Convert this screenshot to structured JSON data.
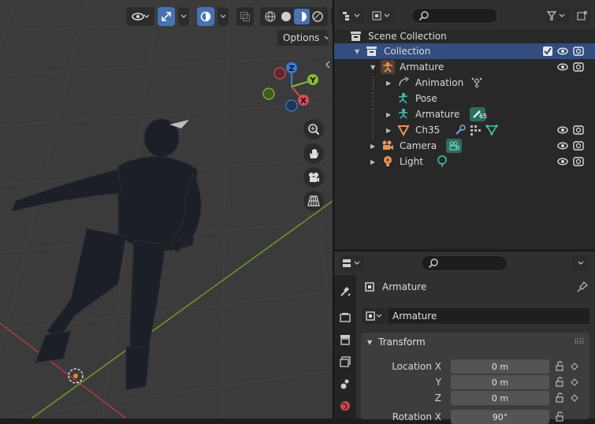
{
  "viewport": {
    "options_label": "Options"
  },
  "outliner": {
    "rows": [
      {
        "label": "Scene Collection"
      },
      {
        "label": "Collection"
      },
      {
        "label": "Armature"
      },
      {
        "label": "Animation"
      },
      {
        "label": "Pose"
      },
      {
        "label": "Armature"
      },
      {
        "label": "Ch35"
      },
      {
        "label": "Camera"
      },
      {
        "label": "Light"
      }
    ],
    "armature_badge": "65"
  },
  "properties": {
    "object_name": "Armature",
    "datablock_name": "Armature",
    "panel_title": "Transform",
    "location_x_label": "Location X",
    "y_label": "Y",
    "z_label": "Z",
    "rotation_x_label": "Rotation X",
    "location_x_value": "0 m",
    "location_y_value": "0 m",
    "location_z_value": "0 m",
    "rotation_x_value": "90°"
  },
  "colors": {
    "selection": "#334d80",
    "accent_blue": "#4772b3",
    "axis_x": "#d94a5a",
    "axis_y": "#8ab836",
    "axis_z": "#3a7dd9"
  }
}
